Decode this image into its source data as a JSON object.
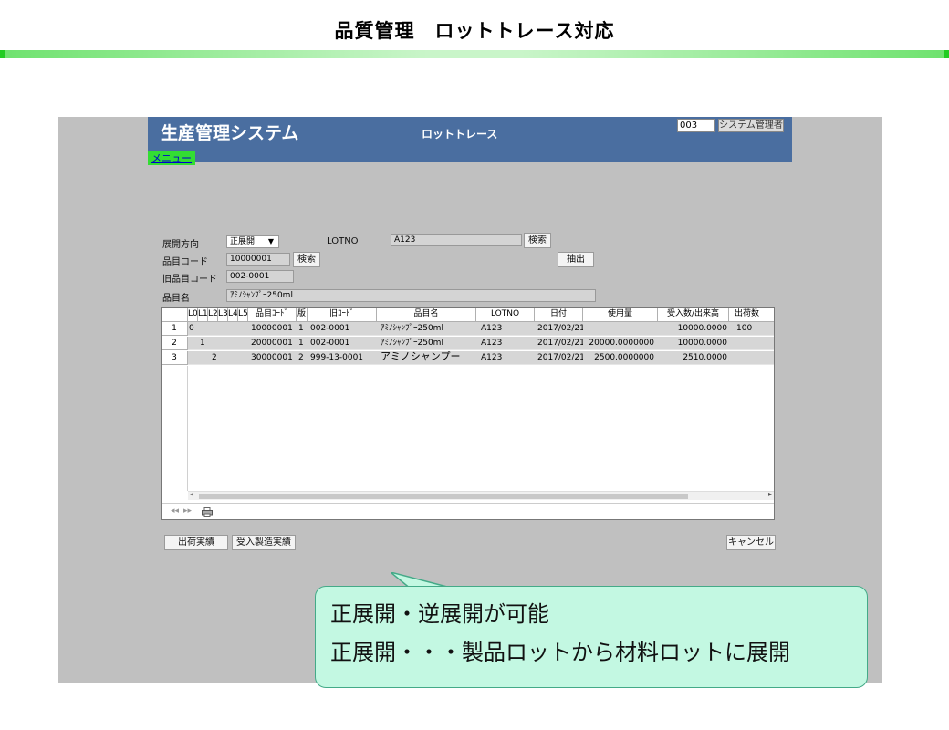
{
  "slide": {
    "title": "品質管理　ロットトレース対応"
  },
  "app": {
    "name": "生産管理システム",
    "screen_title": "ロットトレース",
    "user_id": "003",
    "user_name": "システム管理者",
    "menu_link": "メニュー"
  },
  "form": {
    "direction_label": "展開方向",
    "direction_value": "正展開",
    "lotno_label": "LOTNO",
    "lotno_value": "A123",
    "search_label": "検索",
    "item_code_label": "品目コード",
    "item_code_value": "10000001",
    "old_code_label": "旧品目コード",
    "old_code_value": "002-0001",
    "item_name_label": "品目名",
    "item_name_value": "ｱﾐﾉｼｬﾝﾌﾟｰ250ml",
    "extract_label": "抽出"
  },
  "grid": {
    "headers": [
      "L0",
      "L1",
      "L2",
      "L3",
      "L4",
      "L5",
      "品目ｺｰﾄﾞ",
      "版",
      "旧ｺｰﾄﾞ",
      "品目名",
      "LOTNO",
      "日付",
      "使用量",
      "受入数/出来高",
      "出荷数"
    ],
    "rows": [
      {
        "num": "1",
        "l0": "0",
        "l1": "",
        "l2": "",
        "code": "10000001",
        "ver": "1",
        "old_code": "002-0001",
        "name": "ｱﾐﾉｼｬﾝﾌﾟｰ250ml",
        "lot": "A123",
        "date": "2017/02/21",
        "usage": "",
        "received": "10000.0000",
        "shipped": "100"
      },
      {
        "num": "2",
        "l0": "",
        "l1": "1",
        "l2": "",
        "code": "20000001",
        "ver": "1",
        "old_code": "002-0001",
        "name": "ｱﾐﾉｼｬﾝﾌﾟｰ250ml",
        "lot": "A123",
        "date": "2017/02/21",
        "usage": "20000.0000000",
        "received": "10000.0000",
        "shipped": ""
      },
      {
        "num": "3",
        "l0": "",
        "l1": "",
        "l2": "2",
        "code": "30000001",
        "ver": "2",
        "old_code": "999-13-0001",
        "name": "アミノシャンプー",
        "lot": "A123",
        "date": "2017/02/21",
        "usage": "2500.0000000",
        "received": "2510.0000",
        "shipped": ""
      }
    ]
  },
  "buttons": {
    "shipping_results": "出荷実績",
    "receiving_results": "受入製造実績",
    "cancel": "キャンセル"
  },
  "callout": {
    "line1": "正展開・逆展開が可能",
    "line2": "正展開・・・製品ロットから材料ロットに展開"
  },
  "icons": [
    "dropdown-arrow-icon",
    "first-page-icon",
    "prev-page-icon",
    "printer-icon",
    "scroll-left-icon",
    "scroll-right-icon"
  ]
}
